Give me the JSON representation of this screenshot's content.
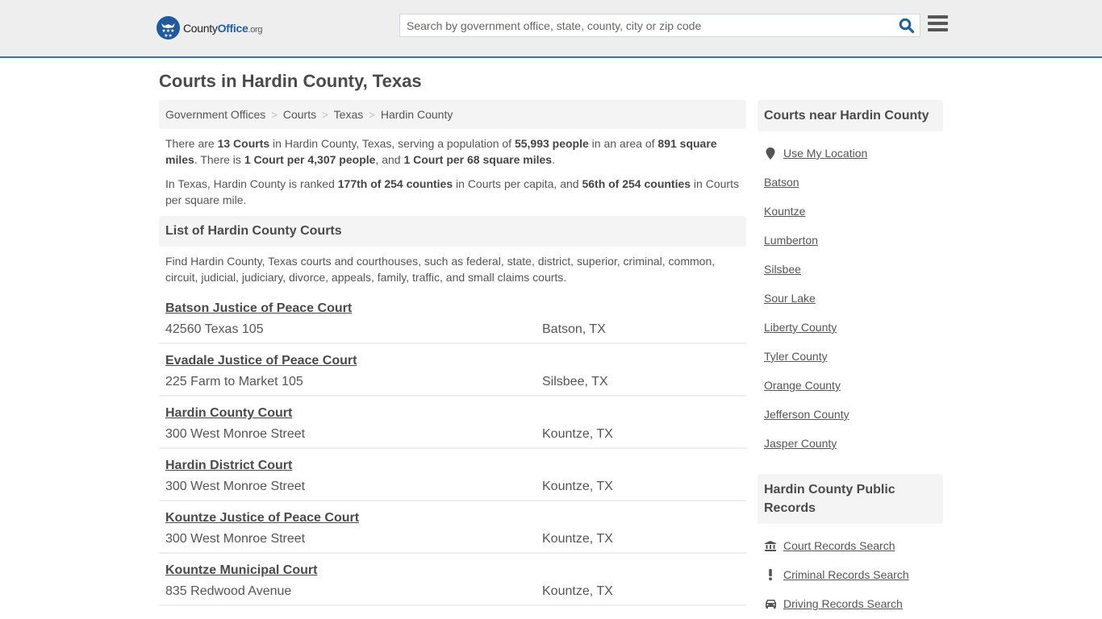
{
  "header": {
    "logo": {
      "part1": "County",
      "part2": "Office",
      "part3": ".org",
      "icon": "eagle-stars-badge-icon",
      "color": "#1f5a9c"
    },
    "search": {
      "placeholder": "Search by government office, state, county, city or zip code",
      "value": "",
      "icon": "search-icon"
    },
    "menu_icon": "hamburger-menu-icon",
    "accent_color": "#2f74ae"
  },
  "page_title": "Courts in Hardin County, Texas",
  "breadcrumb": [
    {
      "label": "Government Offices"
    },
    {
      "label": "Courts"
    },
    {
      "label": "Texas"
    },
    {
      "label": "Hardin County"
    }
  ],
  "summary": {
    "p1": {
      "t1": "There are ",
      "b1": "13 Courts",
      "t2": " in Hardin County, Texas, serving a population of ",
      "b2": "55,993 people",
      "t3": " in an area of ",
      "b3": "891 square miles",
      "t4": ". There is ",
      "b4": "1 Court per 4,307 people",
      "t5": ", and ",
      "b5": "1 Court per 68 square miles",
      "t6": "."
    },
    "p2": {
      "t1": "In Texas, Hardin County is ranked ",
      "b1": "177th of 254 counties",
      "t2": " in Courts per capita, and ",
      "b2": "56th of 254 counties",
      "t3": " in Courts per square mile."
    }
  },
  "list_section": {
    "title": "List of Hardin County Courts",
    "description": "Find Hardin County, Texas courts and courthouses, such as federal, state, district, superior, criminal, common, circuit, judicial, judiciary, divorce, appeals, family, traffic, and small claims courts.",
    "courts": [
      {
        "name": "Batson Justice of Peace Court",
        "address": "42560 Texas 105",
        "city": "Batson, TX"
      },
      {
        "name": "Evadale Justice of Peace Court",
        "address": "225 Farm to Market 105",
        "city": "Silsbee, TX"
      },
      {
        "name": "Hardin County Court",
        "address": "300 West Monroe Street",
        "city": "Kountze, TX"
      },
      {
        "name": "Hardin District Court",
        "address": "300 West Monroe Street",
        "city": "Kountze, TX"
      },
      {
        "name": "Kountze Justice of Peace Court",
        "address": "300 West Monroe Street",
        "city": "Kountze, TX"
      },
      {
        "name": "Kountze Municipal Court",
        "address": "835 Redwood Avenue",
        "city": "Kountze, TX"
      }
    ]
  },
  "sidebar": {
    "nearby": {
      "title": "Courts near Hardin County",
      "use_location": {
        "label": "Use My Location",
        "icon": "map-marker-icon"
      },
      "links": [
        "Batson",
        "Kountze",
        "Lumberton",
        "Silsbee",
        "Sour Lake",
        "Liberty County",
        "Tyler County",
        "Orange County",
        "Jefferson County",
        "Jasper County"
      ]
    },
    "records": {
      "title": "Hardin County Public Records",
      "links": [
        {
          "label": "Court Records Search",
          "icon": "courthouse-icon"
        },
        {
          "label": "Criminal Records Search",
          "icon": "exclamation-icon"
        },
        {
          "label": "Driving Records Search",
          "icon": "car-icon"
        }
      ]
    }
  }
}
